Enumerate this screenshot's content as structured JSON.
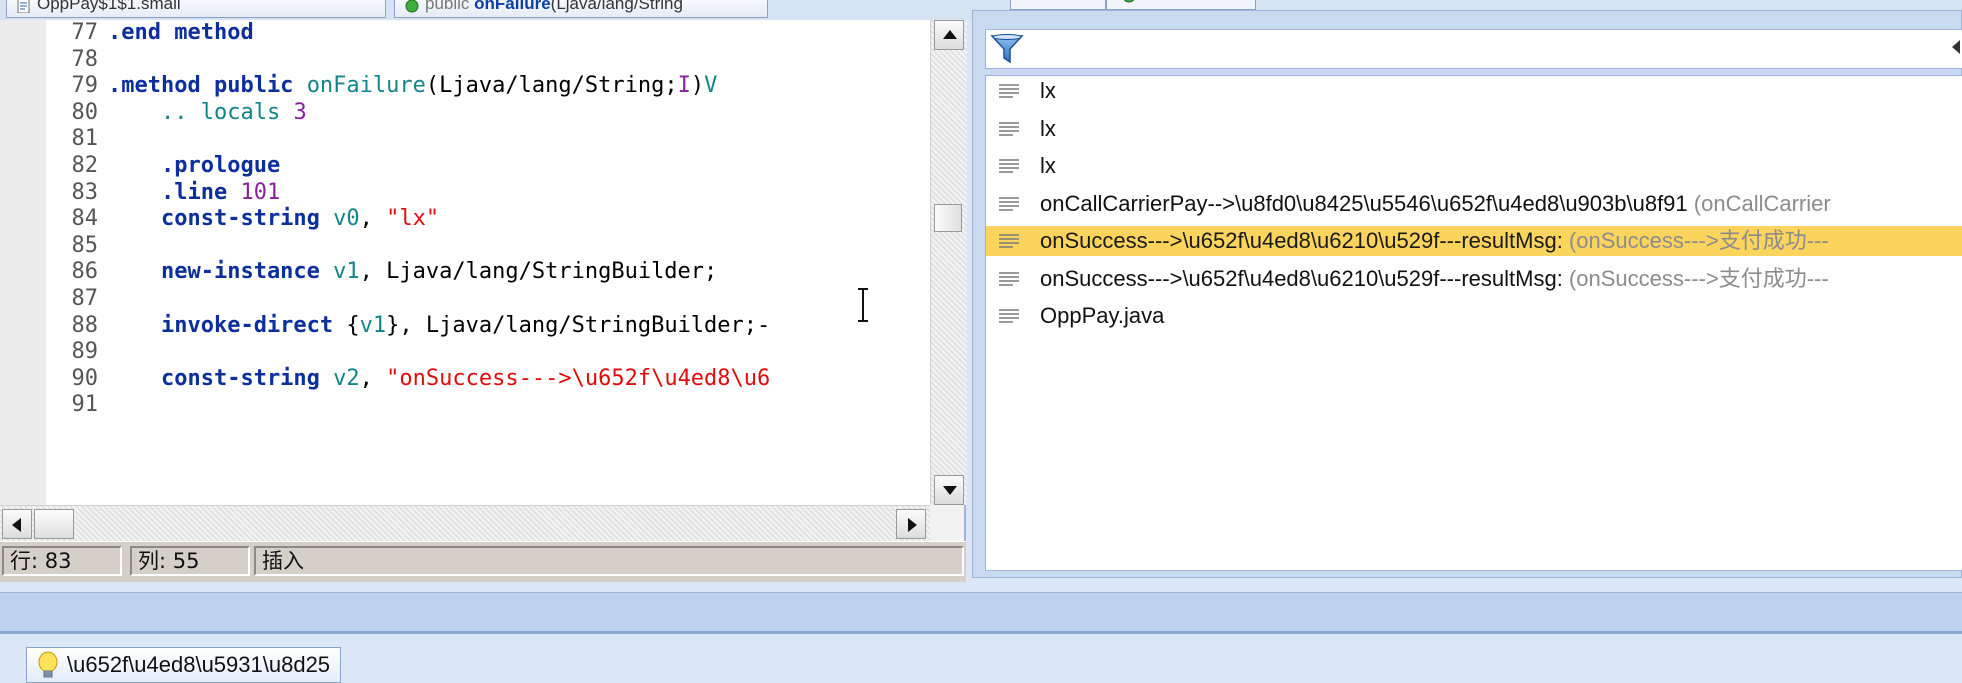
{
  "top_tabs": [
    {
      "label": "OppPay$1$1.smali"
    },
    {
      "label_pre": "public ",
      "label_bold": "onFailure",
      "label_post": "(Ljava/lang/String"
    }
  ],
  "editor": {
    "lines": [
      {
        "n": "77",
        "parts": [
          {
            "t": ".end method",
            "c": "kw"
          }
        ]
      },
      {
        "n": "78",
        "parts": []
      },
      {
        "n": "79",
        "parts": [
          {
            "t": ".method public ",
            "c": "kw"
          },
          {
            "t": "onFailure",
            "c": "fn"
          },
          {
            "t": "(Ljava/lang/String;",
            "c": "tx"
          },
          {
            "t": "I",
            "c": "num"
          },
          {
            "t": ")",
            "c": "tx"
          },
          {
            "t": "V",
            "c": "teal"
          }
        ]
      },
      {
        "n": "80",
        "parts": [
          {
            "t": "    .. locals ",
            "c": "teal"
          },
          {
            "t": "3",
            "c": "num"
          }
        ]
      },
      {
        "n": "81",
        "parts": []
      },
      {
        "n": "82",
        "parts": [
          {
            "t": "    .prologue",
            "c": "kw"
          }
        ]
      },
      {
        "n": "83",
        "parts": [
          {
            "t": "    .line ",
            "c": "kw"
          },
          {
            "t": "101",
            "c": "num"
          }
        ]
      },
      {
        "n": "84",
        "parts": [
          {
            "t": "    const-string ",
            "c": "kw"
          },
          {
            "t": "v0",
            "c": "teal"
          },
          {
            "t": ", ",
            "c": "tx"
          },
          {
            "t": "\"lx\"",
            "c": "str"
          }
        ]
      },
      {
        "n": "85",
        "parts": []
      },
      {
        "n": "86",
        "parts": [
          {
            "t": "    new-instance ",
            "c": "kw"
          },
          {
            "t": "v1",
            "c": "teal"
          },
          {
            "t": ", Ljava/lang/StringBuilder;",
            "c": "tx"
          }
        ]
      },
      {
        "n": "87",
        "parts": []
      },
      {
        "n": "88",
        "parts": [
          {
            "t": "    invoke-direct ",
            "c": "kw"
          },
          {
            "t": "{",
            "c": "tx"
          },
          {
            "t": "v1",
            "c": "teal"
          },
          {
            "t": "}, Ljava/lang/StringBuilder;-",
            "c": "tx"
          }
        ]
      },
      {
        "n": "89",
        "parts": []
      },
      {
        "n": "90",
        "parts": [
          {
            "t": "    const-string ",
            "c": "kw"
          },
          {
            "t": "v2",
            "c": "teal"
          },
          {
            "t": ", ",
            "c": "tx"
          },
          {
            "t": "\"onSuccess--->\\u652f\\u4ed8\\u6",
            "c": "str"
          }
        ]
      },
      {
        "n": "91",
        "parts": []
      }
    ]
  },
  "status": {
    "row": "行: 83",
    "col": "列: 55",
    "mode": "插入"
  },
  "search": {
    "filter_placeholder": "",
    "results": [
      {
        "main": "lx",
        "hint": ""
      },
      {
        "main": "lx",
        "hint": ""
      },
      {
        "main": "lx",
        "hint": ""
      },
      {
        "main": "onCallCarrierPay-->\\u8fd0\\u8425\\u5546\\u652f\\u4ed8\\u903b\\u8f91 ",
        "hint": "(onCallCarrier"
      },
      {
        "main": "onSuccess--->\\u652f\\u4ed8\\u6210\\u529f---resultMsg: ",
        "hint": "(onSuccess--->支付成功---"
      },
      {
        "main": "onSuccess--->\\u652f\\u4ed8\\u6210\\u529f---resultMsg: ",
        "hint": "(onSuccess--->支付成功---"
      },
      {
        "main": "OppPay.java",
        "hint": ""
      }
    ],
    "selected_index": 4
  },
  "bottom": {
    "tip_label": "\\u652f\\u4ed8\\u5931\\u8d25"
  },
  "colors": {
    "selection": "#fbd45d",
    "keyword": "#0c2f9c",
    "string": "#e10b0b",
    "register": "#12858a",
    "number": "#8b1f9d"
  },
  "icons": [
    "file-icon",
    "method-icon",
    "filter-icon",
    "text-lines-icon",
    "lightbulb-icon",
    "text-cursor-icon"
  ]
}
